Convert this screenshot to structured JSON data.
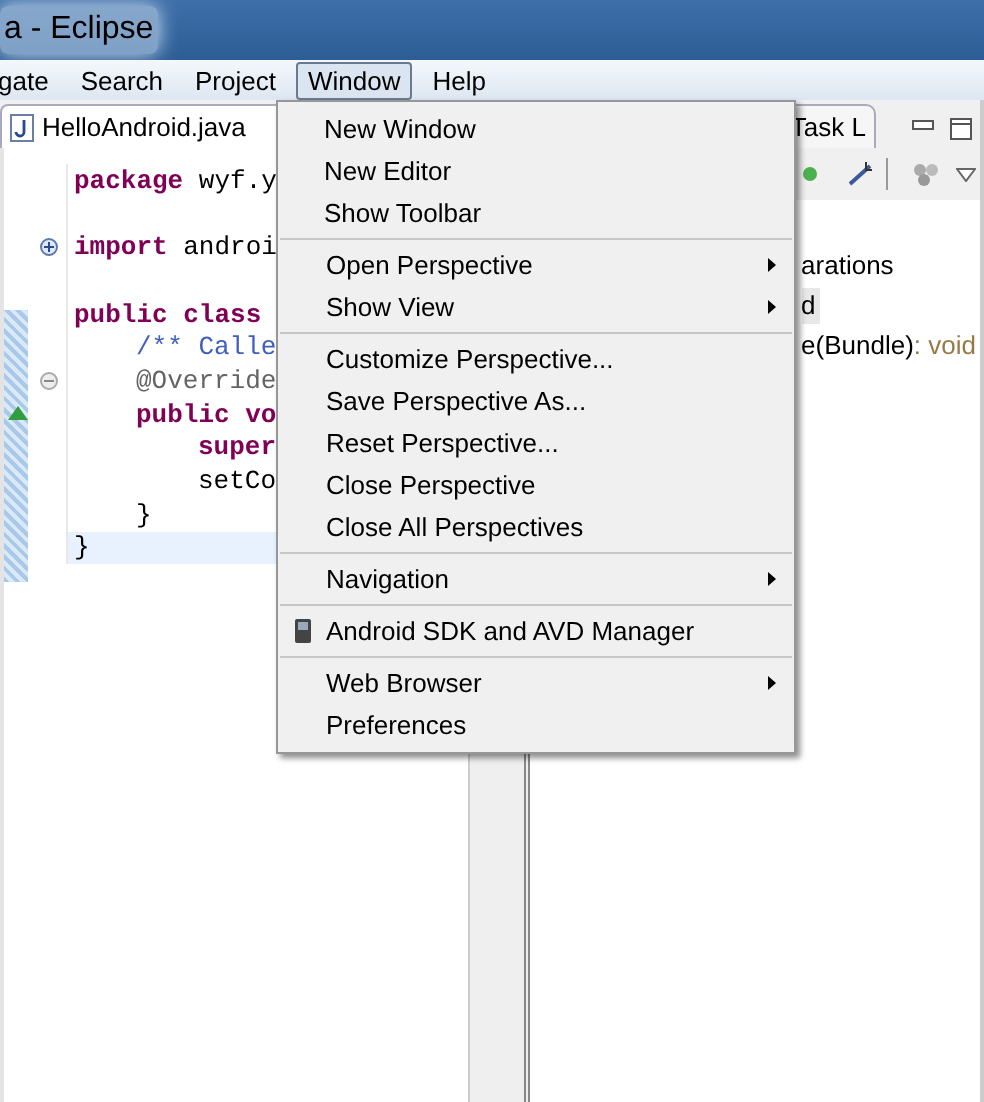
{
  "window": {
    "title": "a - Eclipse"
  },
  "menu_bar": [
    {
      "label": "gate",
      "selected": false
    },
    {
      "label": "Search",
      "selected": false
    },
    {
      "label": "Project",
      "selected": false
    },
    {
      "label": "Window",
      "selected": true
    },
    {
      "label": "Help",
      "selected": false
    }
  ],
  "editor": {
    "tab": {
      "label": "HelloAndroid.java"
    },
    "lines": [
      {
        "current": false,
        "tokens": [
          {
            "kind": "keyword",
            "text": "package"
          },
          {
            "kind": "plain",
            "text": " wyf.y"
          }
        ]
      },
      {
        "current": false
      },
      {
        "current": false,
        "collapsed": true,
        "tokens": [
          {
            "kind": "keyword",
            "text": "import"
          },
          {
            "kind": "plain",
            "text": " androi"
          }
        ]
      },
      {
        "current": false
      },
      {
        "current": false,
        "tokens": [
          {
            "kind": "keyword",
            "text": "public class"
          }
        ],
        "children": [
          {
            "current": false,
            "tokens": [
              {
                "kind": "comment",
                "text": "/** Calle"
              }
            ]
          },
          {
            "current": false,
            "collapsed": false,
            "tokens": [
              {
                "kind": "annotation",
                "text": "@Override"
              }
            ]
          },
          {
            "current": false,
            "marker": true,
            "tokens": [
              {
                "kind": "keyword",
                "text": "public vo"
              }
            ],
            "children": [
              {
                "current": false,
                "tokens": [
                  {
                    "kind": "keyword",
                    "text": "super"
                  }
                ]
              },
              {
                "current": false,
                "tokens": [
                  {
                    "kind": "plain",
                    "text": "setCo"
                  }
                ]
              }
            ]
          },
          {
            "current": false,
            "tokens": [
              {
                "kind": "plain",
                "text": "}"
              }
            ]
          }
        ]
      },
      {
        "current": true,
        "tokens": [
          {
            "kind": "plain",
            "text": "}"
          }
        ]
      }
    ]
  },
  "side_panel": {
    "tab": {
      "label": "Task L"
    },
    "outline": [
      {
        "name": "arations",
        "selected": false
      },
      {
        "name": "d",
        "selected": true
      },
      {
        "name": "e(Bundle)",
        "type": " : void",
        "selected": false
      }
    ]
  },
  "window_menu": {
    "groups": [
      [
        {
          "label": "New Window",
          "submenu": false
        },
        {
          "label": "New Editor",
          "submenu": false
        },
        {
          "label": "Show Toolbar",
          "submenu": false
        }
      ],
      [
        {
          "label": "Open Perspective",
          "submenu": true
        },
        {
          "label": "Show View",
          "submenu": true
        }
      ],
      [
        {
          "label": "Customize Perspective...",
          "submenu": false
        },
        {
          "label": "Save Perspective As...",
          "submenu": false
        },
        {
          "label": "Reset Perspective...",
          "submenu": false
        },
        {
          "label": "Close Perspective",
          "submenu": false
        },
        {
          "label": "Close All Perspectives",
          "submenu": false
        }
      ],
      [
        {
          "label": "Navigation",
          "submenu": true
        }
      ],
      [
        {
          "label": "Android SDK and AVD Manager",
          "submenu": false,
          "kind": "device"
        }
      ],
      [
        {
          "label": "Web Browser",
          "submenu": true
        },
        {
          "label": "Preferences",
          "submenu": false
        }
      ]
    ]
  }
}
